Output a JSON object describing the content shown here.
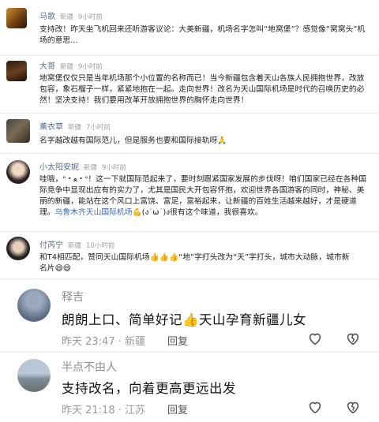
{
  "comments": [
    {
      "name": "马歌",
      "location": "新疆",
      "time": "9小时前",
      "text": "支持改！昨天坐飞机回来还听游客议论：大美新疆，机场名字怎叫“地窝堡”？感觉像“窝窝头”机场的意思..."
    },
    {
      "name": "大哥",
      "location": "新疆",
      "time": "9小时前",
      "text": "地窝堡仅仅只是当年机场那个小位置的名称而已！当今新疆包含着天山各族人民拥抱世界，改放包容，象石榴子一样，紧紧地抱在一起。走向世界！改名为天山国际机场是时代的召唤历史的必然！坚决支持！我们要用改革开放拥抱世界的胸怀走向世界！"
    },
    {
      "name": "薰衣草",
      "location": "新疆",
      "time": "7小时前",
      "text": "名字越改越有国际范儿，但是服务也要和国际接轨呀🙏"
    },
    {
      "name": "小太阳安妮",
      "location": "新疆",
      "time": "9小时前",
      "text": "哇哦，ᐡ・ﻌ・ᐡ！这一下就国际范起来了，要时刻跟紧国家发展的步伐呀！咱们国家已经在各种国际竞争中显现出应有的实力了，尤其是国民大开包容怀抱，欢迎世界各国游客的同时，神秘、美丽的新疆，能站在这个风口上富饶、富足，富裕起来，让新疆的百姓生活越来越好，才是硬道理。",
      "text_link": "乌鲁木齐天山国际机场",
      "text_tail": "💪(ง˙ω˙)ง很有这个味道，我很喜欢。"
    },
    {
      "name": "付芮宁",
      "location": "新疆",
      "time": "10小时前",
      "text": "和T4相匹配，赞同天山国际机场👍👍👍“地”字打头改为“天”字打头，城市大动脉，城市新名片😄😄"
    }
  ],
  "big_comments": [
    {
      "name": "释吉",
      "text": "朗朗上口、简单好记👍天山孕育新疆儿女",
      "meta": "昨天 23:47 · 新疆",
      "reply": "回复"
    },
    {
      "name": "半点不由人",
      "text": "支持改名，向着更高更远出发",
      "meta": "昨天 21:18 · 江苏",
      "reply": "回复"
    }
  ],
  "colors": {
    "name": "#5a6b8c",
    "link": "#3b6bb5",
    "background": "#e9e9e9"
  },
  "icons": [
    "heart-icon",
    "broken-heart-icon"
  ]
}
